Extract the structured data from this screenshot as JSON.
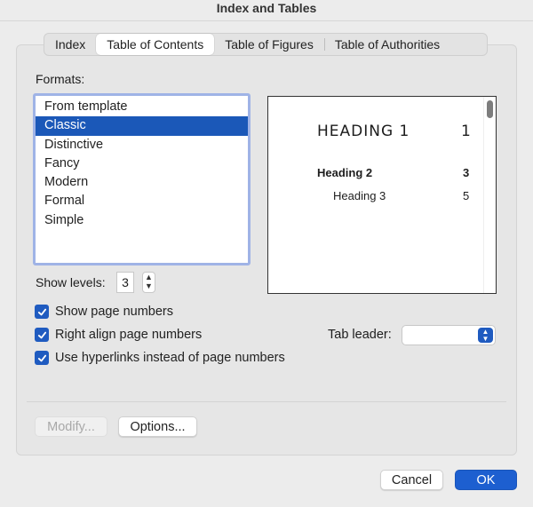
{
  "window": {
    "title": "Index and Tables"
  },
  "tabs": [
    {
      "label": "Index"
    },
    {
      "label": "Table of Contents"
    },
    {
      "label": "Table of Figures"
    },
    {
      "label": "Table of Authorities"
    }
  ],
  "active_tab": "Table of Contents",
  "formats": {
    "label": "Formats:",
    "items": [
      "From template",
      "Classic",
      "Distinctive",
      "Fancy",
      "Modern",
      "Formal",
      "Simple"
    ],
    "selected": "Classic"
  },
  "preview": {
    "heading1": {
      "text": "HEADING 1",
      "page": "1"
    },
    "heading2": {
      "text": "Heading 2",
      "page": "3"
    },
    "heading3": {
      "text": "Heading 3",
      "page": "5"
    }
  },
  "show_levels": {
    "label": "Show levels:",
    "value": "3"
  },
  "options": {
    "show_page_numbers": {
      "label": "Show page numbers",
      "checked": true
    },
    "right_align": {
      "label": "Right align page numbers",
      "checked": true
    },
    "hyperlinks": {
      "label": "Use hyperlinks instead of page numbers",
      "checked": true
    }
  },
  "tab_leader": {
    "label": "Tab leader:",
    "value": ""
  },
  "buttons": {
    "modify": "Modify...",
    "options": "Options...",
    "cancel": "Cancel",
    "ok": "OK"
  },
  "colors": {
    "accent": "#1d5fd0",
    "selection": "#1b58b8"
  }
}
